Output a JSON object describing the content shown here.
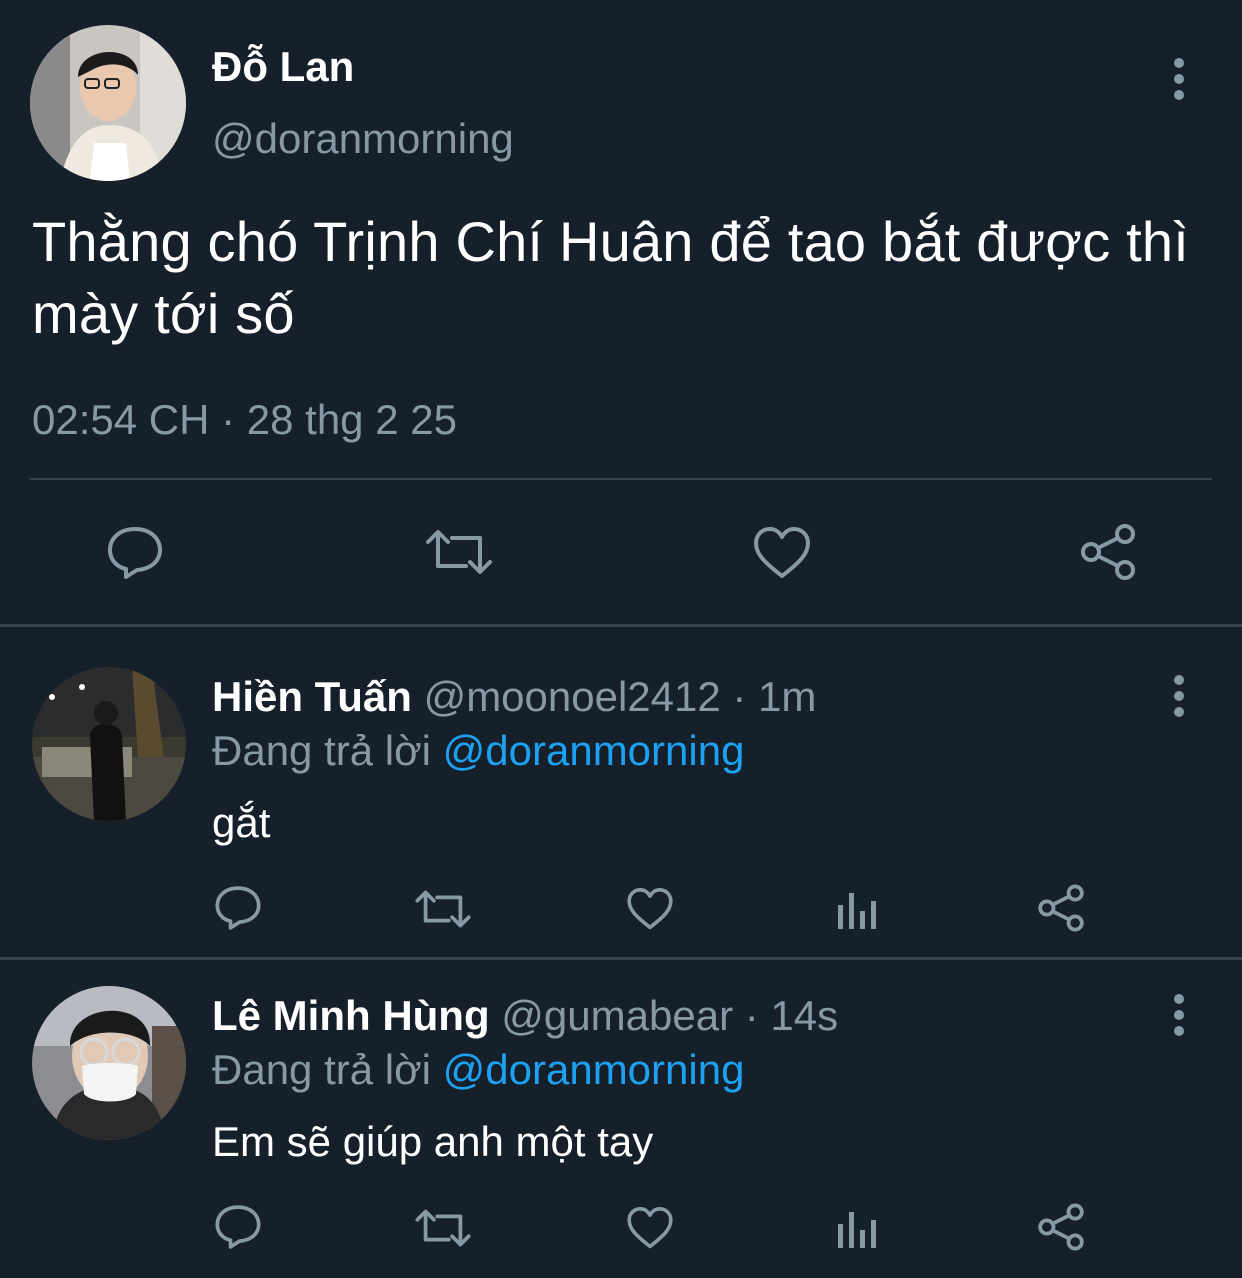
{
  "colors": {
    "background": "#15202b",
    "divider": "#38444d",
    "secondary_text": "#8899a6",
    "link": "#1da1f2",
    "primary_text": "#ffffff"
  },
  "main_tweet": {
    "author_name": "Đỗ Lan",
    "author_handle": "@doranmorning",
    "text": "Thằng chó Trịnh Chí Huân để tao bắt được thì mày tới số",
    "timestamp": "02:54 CH · 28 thg 2 25",
    "actions": [
      "reply-icon",
      "retweet-icon",
      "like-icon",
      "share-icon"
    ]
  },
  "replies": [
    {
      "author_name": "Hiền Tuấn",
      "author_handle": "@moonoel2412",
      "separator": " · ",
      "time": "1m",
      "replying_label": "Đang trả lời",
      "replying_to": "@doranmorning",
      "text": "gắt",
      "actions": [
        "reply-icon",
        "retweet-icon",
        "like-icon",
        "analytics-icon",
        "share-icon"
      ]
    },
    {
      "author_name": "Lê Minh Hùng",
      "author_handle": "@gumabear",
      "separator": " · ",
      "time": "14s",
      "replying_label": "Đang trả lời",
      "replying_to": "@doranmorning",
      "text": "Em sẽ giúp anh một tay",
      "actions": [
        "reply-icon",
        "retweet-icon",
        "like-icon",
        "analytics-icon",
        "share-icon"
      ]
    }
  ]
}
